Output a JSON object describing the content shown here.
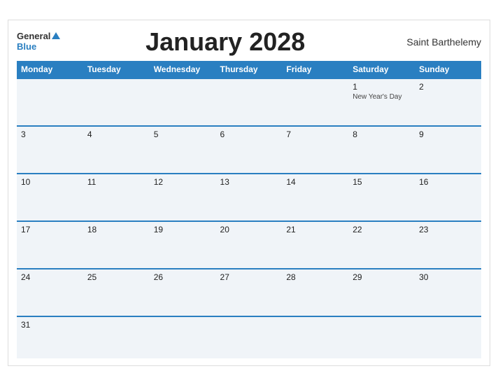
{
  "header": {
    "logo_general": "General",
    "logo_blue": "Blue",
    "title": "January 2028",
    "location": "Saint Barthelemy"
  },
  "weekdays": [
    "Monday",
    "Tuesday",
    "Wednesday",
    "Thursday",
    "Friday",
    "Saturday",
    "Sunday"
  ],
  "weeks": [
    [
      {
        "day": "",
        "holiday": ""
      },
      {
        "day": "",
        "holiday": ""
      },
      {
        "day": "",
        "holiday": ""
      },
      {
        "day": "",
        "holiday": ""
      },
      {
        "day": "",
        "holiday": ""
      },
      {
        "day": "1",
        "holiday": "New Year's Day"
      },
      {
        "day": "2",
        "holiday": ""
      }
    ],
    [
      {
        "day": "3",
        "holiday": ""
      },
      {
        "day": "4",
        "holiday": ""
      },
      {
        "day": "5",
        "holiday": ""
      },
      {
        "day": "6",
        "holiday": ""
      },
      {
        "day": "7",
        "holiday": ""
      },
      {
        "day": "8",
        "holiday": ""
      },
      {
        "day": "9",
        "holiday": ""
      }
    ],
    [
      {
        "day": "10",
        "holiday": ""
      },
      {
        "day": "11",
        "holiday": ""
      },
      {
        "day": "12",
        "holiday": ""
      },
      {
        "day": "13",
        "holiday": ""
      },
      {
        "day": "14",
        "holiday": ""
      },
      {
        "day": "15",
        "holiday": ""
      },
      {
        "day": "16",
        "holiday": ""
      }
    ],
    [
      {
        "day": "17",
        "holiday": ""
      },
      {
        "day": "18",
        "holiday": ""
      },
      {
        "day": "19",
        "holiday": ""
      },
      {
        "day": "20",
        "holiday": ""
      },
      {
        "day": "21",
        "holiday": ""
      },
      {
        "day": "22",
        "holiday": ""
      },
      {
        "day": "23",
        "holiday": ""
      }
    ],
    [
      {
        "day": "24",
        "holiday": ""
      },
      {
        "day": "25",
        "holiday": ""
      },
      {
        "day": "26",
        "holiday": ""
      },
      {
        "day": "27",
        "holiday": ""
      },
      {
        "day": "28",
        "holiday": ""
      },
      {
        "day": "29",
        "holiday": ""
      },
      {
        "day": "30",
        "holiday": ""
      }
    ],
    [
      {
        "day": "31",
        "holiday": ""
      },
      {
        "day": "",
        "holiday": ""
      },
      {
        "day": "",
        "holiday": ""
      },
      {
        "day": "",
        "holiday": ""
      },
      {
        "day": "",
        "holiday": ""
      },
      {
        "day": "",
        "holiday": ""
      },
      {
        "day": "",
        "holiday": ""
      }
    ]
  ]
}
